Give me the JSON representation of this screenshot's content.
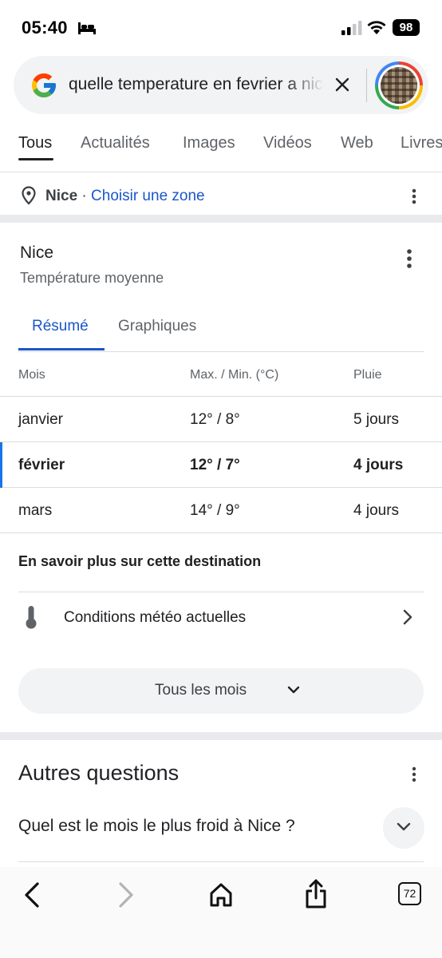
{
  "status_bar": {
    "time": "05:40",
    "battery": "98",
    "icons": [
      "bed-icon",
      "signal-icon",
      "wifi-icon"
    ]
  },
  "search": {
    "query": "quelle temperature en fevrier a nice",
    "clear_icon": "close-icon",
    "logo": "google-g-logo"
  },
  "tabs": [
    {
      "label": "Tous",
      "active": true
    },
    {
      "label": "Actualités"
    },
    {
      "label": "Images"
    },
    {
      "label": "Vidéos"
    },
    {
      "label": "Web"
    },
    {
      "label": "Livres"
    }
  ],
  "location": {
    "city": "Nice",
    "separator": " · ",
    "link": "Choisir une zone"
  },
  "card": {
    "title": "Nice",
    "subtitle": "Température moyenne",
    "subtabs": [
      {
        "label": "Résumé",
        "active": true
      },
      {
        "label": "Graphiques"
      }
    ],
    "headers": {
      "month": "Mois",
      "temp": "Max. / Min. (°C)",
      "rain": "Pluie"
    },
    "rows": [
      {
        "month": "janvier",
        "temp": "12° / 8°",
        "rain": "5 jours",
        "current": false
      },
      {
        "month": "février",
        "temp": "12° / 7°",
        "rain": "4 jours",
        "current": true
      },
      {
        "month": "mars",
        "temp": "14° / 9°",
        "rain": "4 jours",
        "current": false
      }
    ],
    "learn_more": "En savoir plus sur cette destination",
    "conditions": "Conditions météo actuelles",
    "all_months": "Tous les mois"
  },
  "paa": {
    "title": "Autres questions",
    "questions": [
      "Quel est le mois le plus froid à Nice ?"
    ]
  },
  "toolbar": {
    "tab_count": "72"
  },
  "colors": {
    "accent_blue": "#1a56c9",
    "divider": "#dadce0",
    "panel_gray": "#f1f3f4"
  }
}
